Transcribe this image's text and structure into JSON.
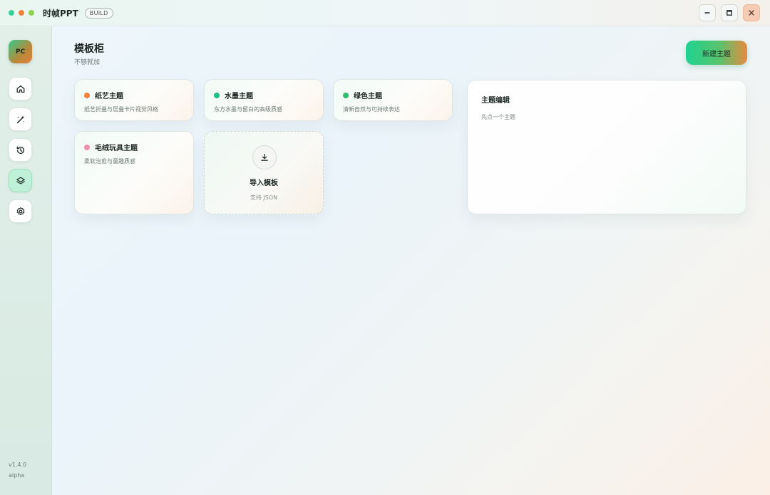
{
  "titlebar": {
    "app_name": "时帧PPT",
    "badge": "BUILD",
    "dots": [
      "#35d29a",
      "#f0813c",
      "#8fd14f"
    ],
    "minimize_icon": "minimize-icon",
    "maximize_icon": "maximize-icon",
    "close_icon": "close-icon"
  },
  "sidebar": {
    "avatar": "PC",
    "items": [
      {
        "name": "home",
        "icon": "home-icon",
        "active": false
      },
      {
        "name": "magic",
        "icon": "magic-wand-icon",
        "active": false
      },
      {
        "name": "history",
        "icon": "history-icon",
        "active": true
      },
      {
        "name": "templates",
        "icon": "layers-icon",
        "active": true
      },
      {
        "name": "settings",
        "icon": "gear-icon",
        "active": false
      }
    ],
    "version": "v1.4.0",
    "channel": "alpha"
  },
  "main": {
    "title": "模板柜",
    "subtitle": "不够就加",
    "new_button": "新建主题",
    "themes": [
      {
        "title": "纸艺主题",
        "desc": "纸艺折叠与层叠卡片视觉风格",
        "color": "#f0813c"
      },
      {
        "title": "水墨主题",
        "desc": "东方水墨与留白的高级质感",
        "color": "#1fbf8a"
      },
      {
        "title": "绿色主题",
        "desc": "清新自然与可持续表达",
        "color": "#2fbd6b"
      },
      {
        "title": "毛绒玩具主题",
        "desc": "柔软治愈与童趣质感",
        "color": "#ef8fb0"
      }
    ],
    "import": {
      "icon": "download-icon",
      "title": "导入模板",
      "subtitle": "支持 JSON"
    },
    "editor": {
      "title": "主题编辑",
      "hint": "先点一个主题"
    }
  }
}
